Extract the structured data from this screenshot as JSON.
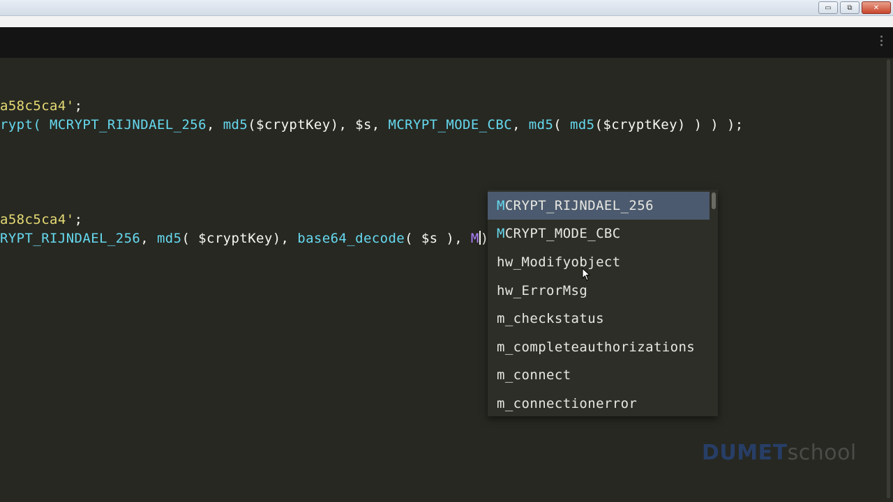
{
  "window": {
    "controls": {
      "minimize": "▭",
      "maximize": "⧉",
      "close": "✕"
    }
  },
  "editor": {
    "lines": [
      {
        "parts": [
          {
            "text": "a58c5ca4'",
            "kind": "str"
          },
          {
            "text": ";",
            "kind": "plain"
          }
        ]
      },
      {
        "parts": [
          {
            "text": "rypt(",
            "kind": "fn"
          },
          {
            "text": " ",
            "kind": "plain"
          },
          {
            "text": "MCRYPT_RIJNDAEL_256",
            "kind": "fn"
          },
          {
            "text": ", ",
            "kind": "plain"
          },
          {
            "text": "md5",
            "kind": "fn"
          },
          {
            "text": "($cryptKey), $s, ",
            "kind": "plain"
          },
          {
            "text": "MCRYPT_MODE_CBC",
            "kind": "fn"
          },
          {
            "text": ", ",
            "kind": "plain"
          },
          {
            "text": "md5",
            "kind": "fn"
          },
          {
            "text": "( ",
            "kind": "plain"
          },
          {
            "text": "md5",
            "kind": "fn"
          },
          {
            "text": "($cryptKey) ) ) );",
            "kind": "plain"
          }
        ]
      },
      {
        "parts": [
          {
            "text": "a58c5ca4'",
            "kind": "str"
          },
          {
            "text": ";",
            "kind": "plain"
          }
        ]
      },
      {
        "parts": [
          {
            "text": "RYPT_RIJNDAEL_256",
            "kind": "fn"
          },
          {
            "text": ", ",
            "kind": "plain"
          },
          {
            "text": "md5",
            "kind": "fn"
          },
          {
            "text": "( $cryptKey), ",
            "kind": "plain"
          },
          {
            "text": "base64_decode",
            "kind": "fn"
          },
          {
            "text": "( $s ), ",
            "kind": "plain"
          },
          {
            "text": "M",
            "kind": "typed"
          },
          {
            "text": "",
            "kind": "cursor"
          },
          {
            "text": "))",
            "kind": "plain"
          }
        ]
      }
    ]
  },
  "autocomplete": {
    "typed_prefix": "M",
    "items": [
      {
        "match": "M",
        "rest": "CRYPT_RIJNDAEL_256",
        "selected": true
      },
      {
        "match": "M",
        "rest": "CRYPT_MODE_CBC",
        "selected": false
      },
      {
        "match": "",
        "rest": "hw_Modifyobject",
        "selected": false
      },
      {
        "match": "",
        "rest": "hw_ErrorMsg",
        "selected": false
      },
      {
        "match": "",
        "rest": "m_checkstatus",
        "selected": false
      },
      {
        "match": "",
        "rest": "m_completeauthorizations",
        "selected": false
      },
      {
        "match": "",
        "rest": "m_connect",
        "selected": false
      },
      {
        "match": "",
        "rest": "m_connectionerror",
        "selected": false
      }
    ]
  },
  "watermark": {
    "brand": "DUMET",
    "suffix": "school"
  },
  "colors": {
    "editor_bg": "#272822",
    "string": "#e6db74",
    "function": "#66d9ef",
    "typed": "#ae81ff",
    "popup_bg": "#2d2e27",
    "popup_selected": "#4b5a6e"
  }
}
